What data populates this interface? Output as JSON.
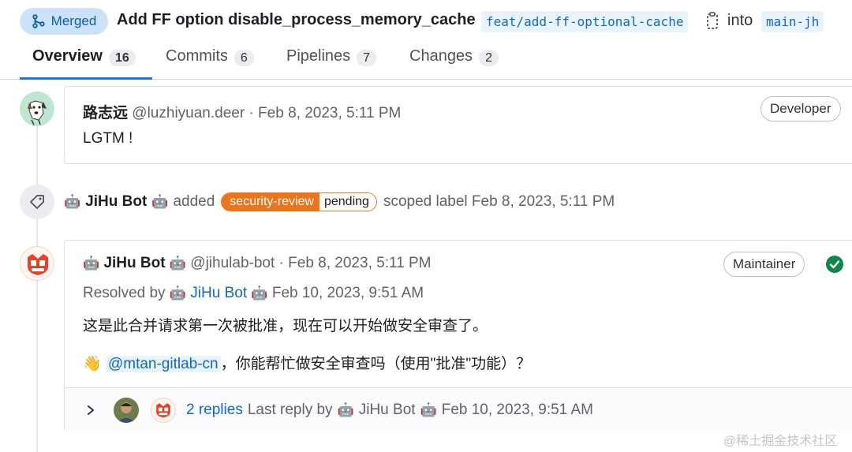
{
  "header": {
    "status_label": "Merged",
    "title": "Add FF option disable_process_memory_cache",
    "source_branch": "feat/add-ff-optional-cache",
    "into_text": "into",
    "target_branch": "main-jh",
    "status_color": "#cbe2f9"
  },
  "tabs": [
    {
      "label": "Overview",
      "count": "16",
      "active": true
    },
    {
      "label": "Commits",
      "count": "6"
    },
    {
      "label": "Pipelines",
      "count": "7"
    },
    {
      "label": "Changes",
      "count": "2"
    }
  ],
  "notes": {
    "first": {
      "author_name": "路志远",
      "author_handle": "@luzhiyuan.deer",
      "timestamp": "· Feb 8, 2023, 5:11 PM",
      "role": "Developer",
      "body": "LGTM !"
    },
    "system": {
      "emoji": "🤖",
      "author": "JiHu Bot",
      "action": "added",
      "label_key": "security-review",
      "label_value": "pending",
      "suffix": "scoped label Feb 8, 2023, 5:11 PM",
      "label_color": "#e9751c"
    },
    "second": {
      "author_name": "JiHu Bot",
      "author_handle": "@jihulab-bot",
      "timestamp": "· Feb 8, 2023, 5:11 PM",
      "role": "Maintainer",
      "resolved_prefix": "Resolved by",
      "resolved_by": "JiHu Bot",
      "resolved_time": "Feb 10, 2023, 9:51 AM",
      "body_line1": "这是此合并请求第一次被批准，现在可以开始做安全审查了。",
      "wave": "👋",
      "mention": "@mtan-gitlab-cn",
      "body_line2": "，你能帮忙做安全审查吗（使用\"批准\"功能）？"
    },
    "replies": {
      "count_text": "2 replies",
      "last_reply_prefix": "Last reply by",
      "last_reply_author": "JiHu Bot",
      "last_reply_time": "Feb 10, 2023, 9:51 AM"
    }
  },
  "icons": {
    "merge": "git-merge-icon",
    "copy": "copy-icon",
    "tag": "tag-icon",
    "resolved": "check-circle-icon",
    "expand": "chevron-right-icon"
  },
  "watermark": "@稀土掘金技术社区"
}
